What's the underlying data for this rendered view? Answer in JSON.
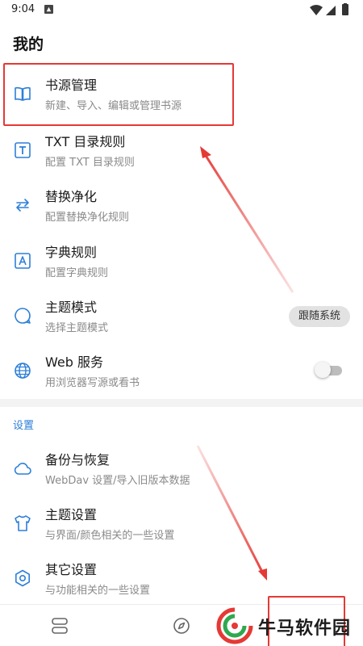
{
  "status_bar": {
    "time": "9:04"
  },
  "page_title": "我的",
  "menu": [
    {
      "title": "书源管理",
      "subtitle": "新建、导入、编辑或管理书源",
      "icon": "book-open-icon"
    },
    {
      "title": "TXT 目录规则",
      "subtitle": "配置 TXT 目录规则",
      "icon": "text-box-icon"
    },
    {
      "title": "替换净化",
      "subtitle": "配置替换净化规则",
      "icon": "swap-icon"
    },
    {
      "title": "字典规则",
      "subtitle": "配置字典规则",
      "icon": "dictionary-icon"
    },
    {
      "title": "主题模式",
      "subtitle": "选择主题模式",
      "icon": "theme-bubble-icon",
      "chip": "跟随系统"
    },
    {
      "title": "Web 服务",
      "subtitle": "用浏览器写源或看书",
      "icon": "globe-icon",
      "toggle_on": false
    }
  ],
  "settings_section": {
    "label": "设置",
    "items": [
      {
        "title": "备份与恢复",
        "subtitle": "WebDav 设置/导入旧版本数据",
        "icon": "cloud-icon"
      },
      {
        "title": "主题设置",
        "subtitle": "与界面/颜色相关的一些设置",
        "icon": "shirt-icon"
      },
      {
        "title": "其它设置",
        "subtitle": "与功能相关的一些设置",
        "icon": "hexagon-gear-icon"
      }
    ]
  },
  "bottom_nav": [
    "bookshelf-icon",
    "compass-icon"
  ],
  "watermark": {
    "text": "牛马软件园"
  },
  "colors": {
    "accent": "#2d7fd8",
    "highlight": "#e53935",
    "icon_blue": "#2d7fd8"
  }
}
